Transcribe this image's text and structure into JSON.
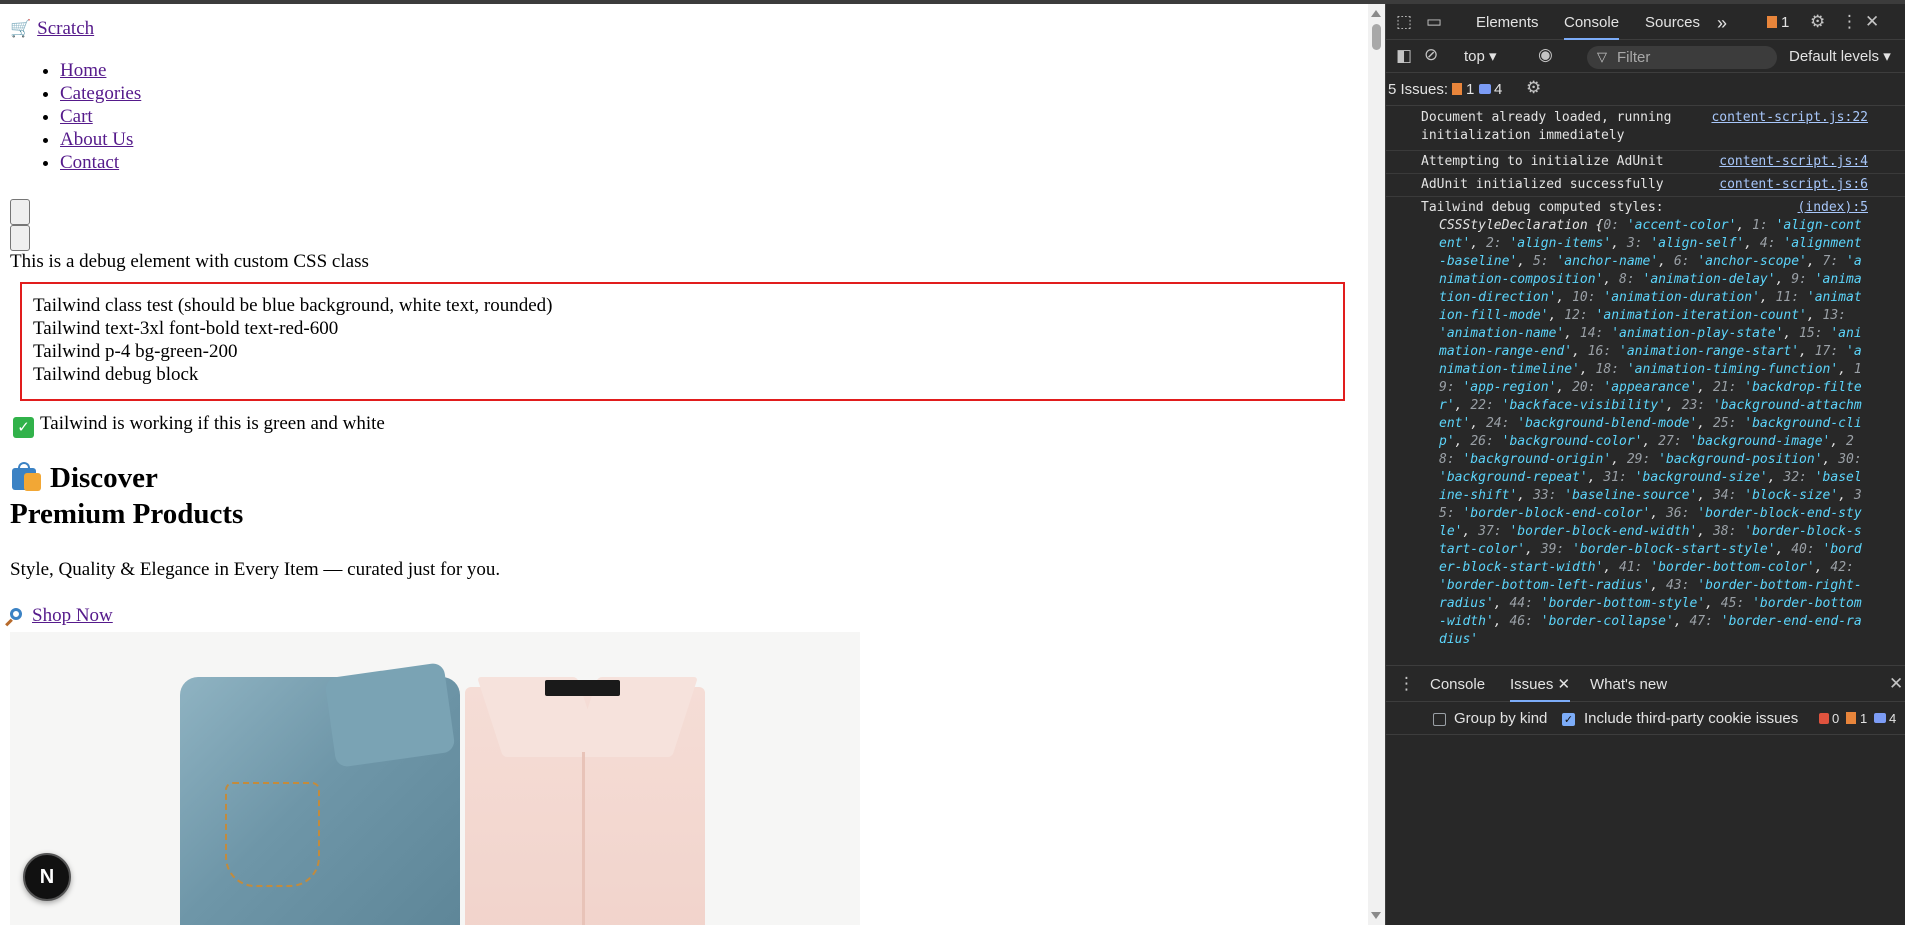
{
  "page": {
    "brand": "Scratch",
    "nav": [
      "Home",
      "Categories",
      "Cart",
      "About Us",
      "Contact"
    ],
    "debug_text": "This is a debug element with custom CSS class",
    "tailwind_lines": [
      "Tailwind class test (should be blue background, white text, rounded)",
      "Tailwind text-3xl font-bold text-red-600",
      "Tailwind p-4 bg-green-200",
      "Tailwind debug block"
    ],
    "working_text": "Tailwind is working if this is green and white",
    "hero_title_1": "Discover",
    "hero_title_2": "Premium Products",
    "tagline": "Style, Quality & Elegance in Every Item — curated just for you.",
    "shop_now": "Shop Now",
    "next_badge": "N",
    "check_glyph": "✓",
    "cart_glyph": "🛒"
  },
  "devtools": {
    "tabs": [
      "Elements",
      "Console",
      "Sources"
    ],
    "active_tab": "Console",
    "more_tabs": "»",
    "warning_count": "1",
    "context": "top ▾",
    "filter_placeholder": "Filter",
    "levels": "Default levels ▾",
    "issues_label": "5 Issues:",
    "issues_warn": "1",
    "issues_info": "4",
    "messages": [
      {
        "text": "Document already loaded, running initialization immediately",
        "source": "content-script.js:22"
      },
      {
        "text": "Attempting to initialize AdUnit",
        "source": "content-script.js:4"
      },
      {
        "text": "AdUnit initialized successfully",
        "source": "content-script.js:6"
      },
      {
        "text": "Tailwind debug computed styles:",
        "source": "(index):5"
      }
    ],
    "css_decl_prefix": "CSSStyleDeclaration {",
    "css_props": [
      "accent-color",
      "align-content",
      "align-items",
      "align-self",
      "alignment-baseline",
      "anchor-name",
      "anchor-scope",
      "animation-composition",
      "animation-delay",
      "animation-direction",
      "animation-duration",
      "animation-fill-mode",
      "animation-iteration-count",
      "animation-name",
      "animation-play-state",
      "animation-range-end",
      "animation-range-start",
      "animation-timeline",
      "animation-timing-function",
      "app-region",
      "appearance",
      "backdrop-filter",
      "backface-visibility",
      "background-attachment",
      "background-blend-mode",
      "background-clip",
      "background-color",
      "background-image",
      "background-origin",
      "background-position",
      "background-repeat",
      "background-size",
      "baseline-shift",
      "baseline-source",
      "block-size",
      "border-block-end-color",
      "border-block-end-style",
      "border-block-end-width",
      "border-block-start-color",
      "border-block-start-style",
      "border-block-start-width",
      "border-bottom-color",
      "border-bottom-left-radius",
      "border-bottom-right-radius",
      "border-bottom-style",
      "border-bottom-width",
      "border-collapse",
      "border-end-end-radius"
    ],
    "drawer_tabs": [
      "Console",
      "Issues",
      "What's new"
    ],
    "drawer_active": "Issues",
    "group_by_kind": "Group by kind",
    "include_third_party": "Include third-party cookie issues",
    "drawer_err": "0",
    "drawer_warn": "1",
    "drawer_info": "4"
  }
}
